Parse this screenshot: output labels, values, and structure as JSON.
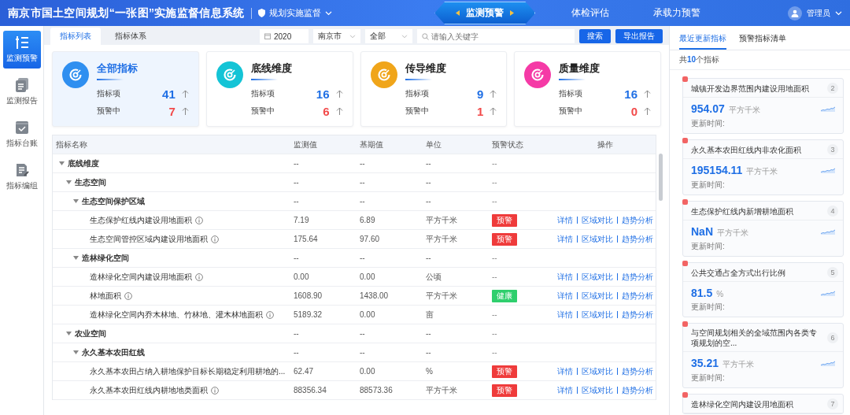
{
  "header": {
    "title": "南京市国土空间规划“一张图”实施监督信息系统",
    "module": "规划实施监督",
    "nav": [
      {
        "label": "监测预警",
        "selected": true
      },
      {
        "label": "体检评估",
        "selected": false
      },
      {
        "label": "承载力预警",
        "selected": false
      }
    ],
    "user": "管理员"
  },
  "sidebar": {
    "items": [
      {
        "label": "监测预警",
        "kind": "list",
        "selected": true
      },
      {
        "label": "监测报告",
        "kind": "report",
        "selected": false
      },
      {
        "label": "指标台账",
        "kind": "check",
        "selected": false
      },
      {
        "label": "指标编组",
        "kind": "edit",
        "selected": false
      }
    ]
  },
  "toolbar": {
    "tabs": [
      {
        "label": "指标列表",
        "selected": true
      },
      {
        "label": "指标体系",
        "selected": false
      }
    ],
    "year": "2020",
    "region": "南京市",
    "scope": "全部",
    "search": {
      "placeholder": "请输入关键字"
    },
    "buttons": [
      "搜索",
      "导出报告"
    ]
  },
  "stat_cards": [
    {
      "title": "全部指标",
      "selected": true,
      "color": "#2f8ff0",
      "rows": [
        {
          "label": "指标项",
          "value": "41",
          "kind": "total"
        },
        {
          "label": "预警中",
          "value": "7",
          "kind": "alert"
        }
      ]
    },
    {
      "title": "底线维度",
      "selected": false,
      "color": "#14c4d6",
      "rows": [
        {
          "label": "指标项",
          "value": "16",
          "kind": "total"
        },
        {
          "label": "预警中",
          "value": "6",
          "kind": "alert"
        }
      ]
    },
    {
      "title": "传导维度",
      "selected": false,
      "color": "#f0a51a",
      "rows": [
        {
          "label": "指标项",
          "value": "9",
          "kind": "total"
        },
        {
          "label": "预警中",
          "value": "1",
          "kind": "alert"
        }
      ]
    },
    {
      "title": "质量维度",
      "selected": false,
      "color": "#f53aa6",
      "rows": [
        {
          "label": "指标项",
          "value": "16",
          "kind": "total"
        },
        {
          "label": "预警中",
          "value": "0",
          "kind": "alert"
        }
      ]
    }
  ],
  "table": {
    "columns": [
      "指标名称",
      "监测值",
      "基期值",
      "单位",
      "预警状态",
      "操作"
    ],
    "rows": [
      {
        "name": "底线维度",
        "monitor": "--",
        "base": "--",
        "unit": "--",
        "status": {
          "label": "--",
          "kind": "none"
        },
        "expanded": true,
        "children": [
          {
            "name": "生态空间",
            "monitor": "--",
            "base": "--",
            "unit": "--",
            "status": {
              "label": "--",
              "kind": "none"
            },
            "expanded": true,
            "children": [
              {
                "name": "生态空间保护区域",
                "monitor": "--",
                "base": "--",
                "unit": "--",
                "status": {
                  "label": "--",
                  "kind": "none"
                },
                "expanded": true,
                "children": [
                  {
                    "name": "生态保护红线内建设用地面积",
                    "info": true,
                    "monitor": "7.19",
                    "base": "6.89",
                    "unit": "平方千米",
                    "status": {
                      "label": "预警",
                      "kind": "alert"
                    },
                    "actions": [
                      "详情",
                      "区域对比",
                      "趋势分析"
                    ]
                  },
                  {
                    "name": "生态空间管控区域内建设用地面积",
                    "info": true,
                    "monitor": "175.64",
                    "base": "97.60",
                    "unit": "平方千米",
                    "status": {
                      "label": "预警",
                      "kind": "alert"
                    },
                    "actions": [
                      "详情",
                      "区域对比",
                      "趋势分析"
                    ]
                  }
                ]
              },
              {
                "name": "造林绿化空间",
                "monitor": "--",
                "base": "--",
                "unit": "--",
                "status": {
                  "label": "--",
                  "kind": "none"
                },
                "expanded": true,
                "children": [
                  {
                    "name": "造林绿化空间内建设用地面积",
                    "info": true,
                    "monitor": "0.00",
                    "base": "0.00",
                    "unit": "公顷",
                    "status": {
                      "label": "--",
                      "kind": "none"
                    },
                    "actions": [
                      "详情",
                      "区域对比",
                      "趋势分析"
                    ]
                  },
                  {
                    "name": "林地面积",
                    "info": true,
                    "monitor": "1608.90",
                    "base": "1438.00",
                    "unit": "平方千米",
                    "status": {
                      "label": "健康",
                      "kind": "healthy"
                    },
                    "actions": [
                      "详情",
                      "区域对比",
                      "趋势分析"
                    ]
                  },
                  {
                    "name": "造林绿化空间内乔木林地、竹林地、灌木林地面积",
                    "info": true,
                    "monitor": "5189.32",
                    "base": "0.00",
                    "unit": "亩",
                    "status": {
                      "label": "--",
                      "kind": "none"
                    },
                    "actions": [
                      "详情",
                      "区域对比",
                      "趋势分析"
                    ]
                  }
                ]
              }
            ]
          },
          {
            "name": "农业空间",
            "monitor": "--",
            "base": "--",
            "unit": "--",
            "status": {
              "label": "--",
              "kind": "none"
            },
            "expanded": true,
            "children": [
              {
                "name": "永久基本农田红线",
                "monitor": "--",
                "base": "--",
                "unit": "--",
                "status": {
                  "label": "--",
                  "kind": "none"
                },
                "expanded": true,
                "children": [
                  {
                    "name": "永久基本农田占纳入耕地保护目标长期稳定利用耕地的...",
                    "info": false,
                    "monitor": "62.47",
                    "base": "0.00",
                    "unit": "%",
                    "status": {
                      "label": "预警",
                      "kind": "alert"
                    },
                    "actions": [
                      "详情",
                      "区域对比",
                      "趋势分析"
                    ]
                  },
                  {
                    "name": "永久基本农田红线内耕地地类面积",
                    "info": true,
                    "monitor": "88356.34",
                    "base": "88573.36",
                    "unit": "平方千米",
                    "status": {
                      "label": "预警",
                      "kind": "alert"
                    },
                    "actions": [
                      "详情",
                      "区域对比",
                      "趋势分析"
                    ]
                  }
                ]
              }
            ]
          }
        ]
      }
    ]
  },
  "side_panel": {
    "tabs": [
      {
        "label": "最近更新指标",
        "selected": true
      },
      {
        "label": "预警指标清单",
        "selected": false
      }
    ],
    "summary": "共**10**个指标",
    "cards": [
      {
        "title": "城镇开发边界范围内建设用地面积",
        "rank": "2",
        "value": "954.07",
        "unit": "平方千米",
        "update_label": "更新时间:"
      },
      {
        "title": "永久基本农田红线内非农化面积",
        "rank": "3",
        "value": "195154.11",
        "unit": "平方千米",
        "update_label": "更新时间:"
      },
      {
        "title": "生态保护红线内新增耕地面积",
        "rank": "4",
        "value": "NaN",
        "unit": "平方千米",
        "update_label": "更新时间:"
      },
      {
        "title": "公共交通占全方式出行比例",
        "rank": "5",
        "value": "81.5",
        "unit": "%",
        "update_label": "更新时间:"
      },
      {
        "title": "与空间规划相关的全域范围内各类专项规划的空...",
        "rank": "6",
        "value": "35.21",
        "unit": "平方千米",
        "update_label": "更新时间:"
      },
      {
        "title": "造林绿化空间内建设用地面积",
        "rank": "7"
      }
    ]
  }
}
